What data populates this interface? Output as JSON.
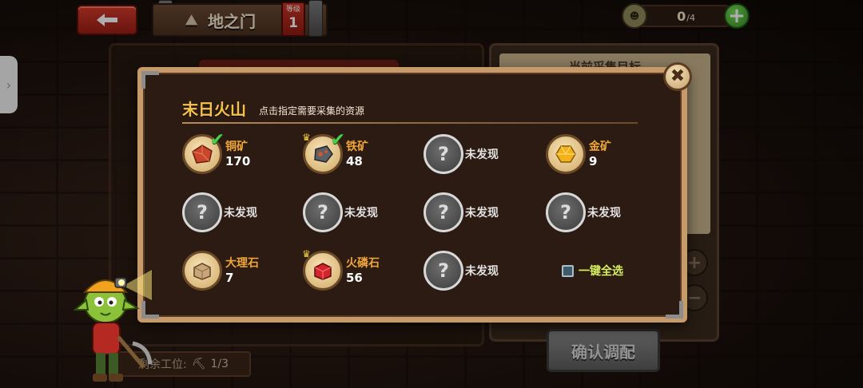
{
  "header": {
    "title": "地之门",
    "level_label": "等级",
    "level_value": "1",
    "workers_current": "0",
    "workers_total": "/4"
  },
  "background": {
    "right_panel_title": "当前采集目标",
    "confirm_label": "确认调配",
    "remaining_label": "剩余工位:",
    "remaining_value": "1/3"
  },
  "modal": {
    "title": "末日火山",
    "subtitle": "点击指定需要采集的资源",
    "select_all_label": "一键全选",
    "unknown_label": "未发现",
    "resources": [
      {
        "name": "铜矿",
        "count": "170",
        "color": "#c8462a",
        "checked": true
      },
      {
        "name": "铁矿",
        "count": "48",
        "color": "#5b6066",
        "checked": true
      },
      {
        "name": "金矿",
        "count": "9",
        "color": "#f2b21c",
        "checked": false
      },
      {
        "name": "大理石",
        "count": "7",
        "color": "#c9a57a",
        "checked": false
      },
      {
        "name": "火磷石",
        "count": "56",
        "color": "#d3232b",
        "checked": false
      }
    ]
  },
  "colors": {
    "accent_title": "#f6c24a",
    "resource_name": "#f0a63a",
    "select_all": "#d7f060",
    "frame": "#c79a6a"
  }
}
